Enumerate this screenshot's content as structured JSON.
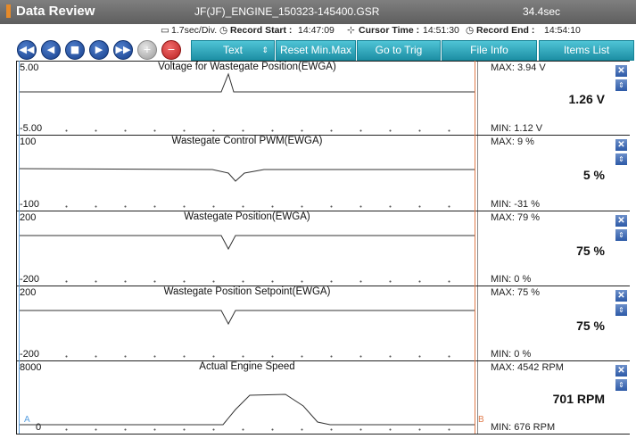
{
  "titlebar": {
    "title": "Data Review",
    "file": "JF(JF)_ENGINE_150323-145400.GSR",
    "duration": "34.4sec"
  },
  "info": {
    "scale": "1.7sec/Div.",
    "record_start_label": "Record Start :",
    "record_start": "14:47:09",
    "cursor_time_label": "Cursor Time :",
    "cursor_time": "14:51:30",
    "record_end_label": "Record End :",
    "record_end": "14:54:10"
  },
  "toolbar": {
    "icons": [
      "rewind-icon",
      "previous-icon",
      "stop-icon",
      "play-icon",
      "fast-forward-icon",
      "zoom-in-icon",
      "zoom-out-icon"
    ],
    "text_select": "Text",
    "reset_label": "Reset Min.Max",
    "go_to_trig_label": "Go to Trig",
    "file_info_label": "File Info",
    "items_list_label": "Items List"
  },
  "panels": [
    {
      "title": "Voltage for Wastegate Position(EWGA)",
      "y_top": "5.00",
      "y_bottom": "-5.00",
      "max": "MAX:  3.94 V",
      "min": "MIN:  1.12 V",
      "current": "1.26 V"
    },
    {
      "title": "Wastegate Control PWM(EWGA)",
      "y_top": "100",
      "y_bottom": "-100",
      "max": "MAX:    9 %",
      "min": "MIN:  -31 %",
      "current": "5 %"
    },
    {
      "title": "Wastegate Position(EWGA)",
      "y_top": "200",
      "y_bottom": "-200",
      "max": "MAX:   79 %",
      "min": "MIN:    0 %",
      "current": "75 %"
    },
    {
      "title": "Wastegate Position Setpoint(EWGA)",
      "y_top": "200",
      "y_bottom": "-200",
      "max": "MAX:   75 %",
      "min": "MIN:    0 %",
      "current": "75 %"
    },
    {
      "title": "Actual Engine Speed",
      "y_top": "8000",
      "y_bottom": "0",
      "max": "MAX:  4542 RPM",
      "min": "MIN:  676 RPM",
      "current": "701 RPM"
    }
  ],
  "cursors": {
    "a": "A",
    "b": "B"
  },
  "colors": {
    "titlebar": "#6b6b6b",
    "accent_btn": "#2fa8bd",
    "nav_btn": "#1f4f9e",
    "cursor_a": "#5aa0e0",
    "cursor_b": "#e07a4a"
  }
}
